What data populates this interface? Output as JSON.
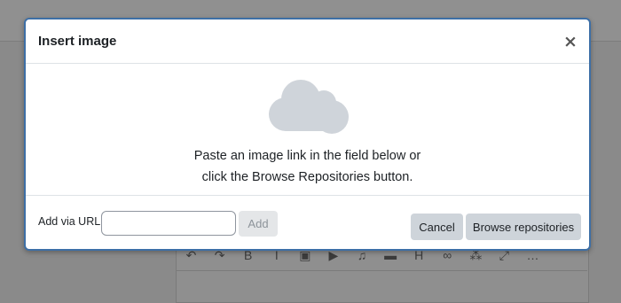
{
  "background": {
    "overlay_color": "#8a8a8a",
    "editor_toolbar_icons": [
      {
        "name": "undo-icon",
        "glyph": "↶"
      },
      {
        "name": "redo-icon",
        "glyph": "↷"
      },
      {
        "name": "bold-icon",
        "glyph": "B"
      },
      {
        "name": "italic-icon",
        "glyph": "I"
      },
      {
        "name": "image-icon",
        "glyph": "▣"
      },
      {
        "name": "media-icon",
        "glyph": "▶"
      },
      {
        "name": "record-audio-icon",
        "glyph": "♫"
      },
      {
        "name": "record-video-icon",
        "glyph": "▬"
      },
      {
        "name": "h5p-icon",
        "glyph": "H"
      },
      {
        "name": "link-icon",
        "glyph": "∞"
      },
      {
        "name": "unlink-icon",
        "glyph": "⁂"
      },
      {
        "name": "fullscreen-icon",
        "glyph": "⤢"
      },
      {
        "name": "more-icon",
        "glyph": "…"
      }
    ]
  },
  "dialog": {
    "title": "Insert image",
    "close_icon": "close-icon",
    "body": {
      "icon": "cloud-icon",
      "instruction_line1": "Paste an image link in the field below or",
      "instruction_line2": "click the Browse Repositories button."
    },
    "footer": {
      "url_label": "Add via URL",
      "url_value": "",
      "add_label": "Add",
      "cancel_label": "Cancel",
      "browse_label": "Browse repositories"
    }
  },
  "colors": {
    "modal_border": "#3d6fa6",
    "cloud": "#cfd4da",
    "button_secondary": "#ced4da",
    "button_disabled": "#e4e6e8"
  }
}
